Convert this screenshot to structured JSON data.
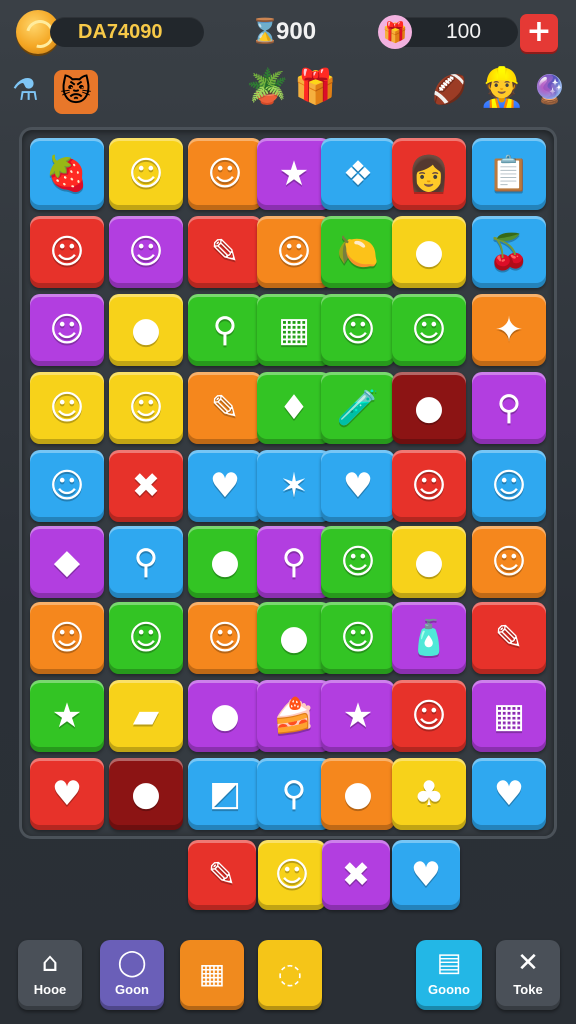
{
  "hud": {
    "coins": "DA74090",
    "score": "900",
    "gems": "100",
    "add_symbol": "+",
    "score_icon": "hourglass-icon",
    "gem_icon": "gift-icon"
  },
  "header_icons": [
    {
      "name": "potion-icon",
      "glyph": "⚗"
    },
    {
      "name": "monster-mask-icon",
      "glyph": "😾"
    },
    {
      "name": "plant-pot-icon",
      "glyph": "🪴"
    },
    {
      "name": "gift-box-icon",
      "glyph": "🎁"
    },
    {
      "name": "ball-icon",
      "glyph": "🏈"
    },
    {
      "name": "avatar-icon",
      "glyph": "👷"
    },
    {
      "name": "crystal-icon",
      "glyph": "🔮"
    }
  ],
  "board": {
    "rows": [
      [
        {
          "color": "blue",
          "glyph": "🍓",
          "icon": "berry-icon"
        },
        {
          "color": "yellow",
          "glyph": "☺",
          "icon": "smiley-icon"
        },
        {
          "color": "orange",
          "glyph": "☺",
          "icon": "smiley-icon"
        },
        {
          "color": "purple",
          "glyph": "★",
          "icon": "star-icon"
        },
        {
          "color": "blue",
          "glyph": "❖",
          "icon": "tooth-icon"
        },
        {
          "color": "red",
          "glyph": "👩",
          "icon": "face-icon"
        },
        {
          "color": "blue",
          "glyph": "📋",
          "icon": "note-icon"
        }
      ],
      [
        {
          "color": "red",
          "glyph": "☺",
          "icon": "sun-face-icon"
        },
        {
          "color": "purple",
          "glyph": "☺",
          "icon": "drop-face-icon"
        },
        {
          "color": "red",
          "glyph": "✎",
          "icon": "pencil-icon"
        },
        {
          "color": "orange",
          "glyph": "☺",
          "icon": "blob-face-icon"
        },
        {
          "color": "green",
          "glyph": "🍋",
          "icon": "lemon-icon"
        },
        {
          "color": "yellow",
          "glyph": "●",
          "icon": "balloon-icon"
        },
        {
          "color": "blue",
          "glyph": "🍒",
          "icon": "cherry-icon"
        }
      ],
      [
        {
          "color": "purple",
          "glyph": "☺",
          "icon": "cat-face-icon"
        },
        {
          "color": "yellow",
          "glyph": "●",
          "icon": "chick-icon"
        },
        {
          "color": "green",
          "glyph": "⚲",
          "icon": "lollipop-icon"
        },
        {
          "color": "green",
          "glyph": "▦",
          "icon": "waffle-icon"
        },
        {
          "color": "green",
          "glyph": "☺",
          "icon": "blob-face-icon"
        },
        {
          "color": "green",
          "glyph": "☺",
          "icon": "ghost-icon"
        },
        {
          "color": "orange",
          "glyph": "✦",
          "icon": "feather-icon"
        }
      ],
      [
        {
          "color": "yellow",
          "glyph": "☺",
          "icon": "cat-face-icon"
        },
        {
          "color": "yellow",
          "glyph": "☺",
          "icon": "blob-face-icon"
        },
        {
          "color": "orange",
          "glyph": "✎",
          "icon": "pencil-icon"
        },
        {
          "color": "green",
          "glyph": "♦",
          "icon": "candy-icon"
        },
        {
          "color": "green",
          "glyph": "🧪",
          "icon": "bottle-icon"
        },
        {
          "color": "maroon",
          "glyph": "●",
          "icon": "green-ball-icon"
        },
        {
          "color": "purple",
          "glyph": "⚲",
          "icon": "lollipop-icon"
        }
      ],
      [
        {
          "color": "blue",
          "glyph": "☺",
          "icon": "chick-icon"
        },
        {
          "color": "red",
          "glyph": "✖",
          "icon": "cross-icon"
        },
        {
          "color": "blue",
          "glyph": "♥",
          "icon": "apple-icon"
        },
        {
          "color": "blue",
          "glyph": "✶",
          "icon": "star-burst-icon"
        },
        {
          "color": "blue",
          "glyph": "♥",
          "icon": "heart-icon"
        },
        {
          "color": "red",
          "glyph": "☺",
          "icon": "blob-face-icon"
        },
        {
          "color": "blue",
          "glyph": "☺",
          "icon": "fish-icon"
        }
      ],
      [
        {
          "color": "purple",
          "glyph": "◆",
          "icon": "cube-icon"
        },
        {
          "color": "blue",
          "glyph": "⚲",
          "icon": "lollipop-icon"
        },
        {
          "color": "green",
          "glyph": "●",
          "icon": "bubble-icon"
        },
        {
          "color": "purple",
          "glyph": "⚲",
          "icon": "lollipop-icon"
        },
        {
          "color": "green",
          "glyph": "☺",
          "icon": "drip-face-icon"
        },
        {
          "color": "yellow",
          "glyph": "●",
          "icon": "pickle-icon"
        },
        {
          "color": "orange",
          "glyph": "☺",
          "icon": "cat-face-icon"
        }
      ],
      [
        {
          "color": "orange",
          "glyph": "☺",
          "icon": "sun-face-icon"
        },
        {
          "color": "green",
          "glyph": "☺",
          "icon": "onion-face-icon"
        },
        {
          "color": "orange",
          "glyph": "☺",
          "icon": "blob-face-icon"
        },
        {
          "color": "green",
          "glyph": "●",
          "icon": "lime-icon"
        },
        {
          "color": "green",
          "glyph": "☺",
          "icon": "tooth-face-icon"
        },
        {
          "color": "purple",
          "glyph": "🧴",
          "icon": "jar-icon"
        },
        {
          "color": "red",
          "glyph": "✎",
          "icon": "crayon-icon"
        }
      ],
      [
        {
          "color": "green",
          "glyph": "★",
          "icon": "star-icon"
        },
        {
          "color": "yellow",
          "glyph": "▰",
          "icon": "eraser-icon"
        },
        {
          "color": "purple",
          "glyph": "●",
          "icon": "orb-icon"
        },
        {
          "color": "purple",
          "glyph": "🍰",
          "icon": "cake-icon"
        },
        {
          "color": "purple",
          "glyph": "★",
          "icon": "star-icon"
        },
        {
          "color": "red",
          "glyph": "☺",
          "icon": "blob-face-icon"
        },
        {
          "color": "purple",
          "glyph": "▦",
          "icon": "calculator-icon"
        }
      ],
      [
        {
          "color": "red",
          "glyph": "♥",
          "icon": "heart-icon"
        },
        {
          "color": "maroon",
          "glyph": "●",
          "icon": "balloon-icon"
        },
        {
          "color": "blue",
          "glyph": "◩",
          "icon": "note-icon"
        },
        {
          "color": "blue",
          "glyph": "⚲",
          "icon": "lollipop-icon"
        },
        {
          "color": "orange",
          "glyph": "●",
          "icon": "bubble-icon"
        },
        {
          "color": "yellow",
          "glyph": "♣",
          "icon": "berry-icon"
        },
        {
          "color": "blue",
          "glyph": "♥",
          "icon": "apple-icon"
        }
      ]
    ]
  },
  "spare_row": [
    {
      "color": "red",
      "glyph": "✎",
      "icon": "feather-icon"
    },
    {
      "color": "yellow",
      "glyph": "☺",
      "icon": "chick-icon"
    },
    {
      "color": "purple",
      "glyph": "✖",
      "icon": "cross-icon"
    },
    {
      "color": "blue",
      "glyph": "♥",
      "icon": "apple-icon"
    }
  ],
  "nav": [
    {
      "label": "Hooe",
      "icon": "home-icon",
      "glyph": "⌂",
      "color": "#4a5058"
    },
    {
      "label": "Goon",
      "icon": "bag-icon",
      "glyph": "◯",
      "color": "#6a5fb8"
    },
    {
      "label": "",
      "icon": "calendar-icon",
      "glyph": "▦",
      "color": "#f08a1e"
    },
    {
      "label": "",
      "icon": "chat-icon",
      "glyph": "◌",
      "color": "#f5c518"
    },
    {
      "label": "Goono",
      "icon": "shop-icon",
      "glyph": "▤",
      "color": "#23b7e6"
    },
    {
      "label": "Toke",
      "icon": "tools-icon",
      "glyph": "✕",
      "color": "#4a5058"
    }
  ]
}
